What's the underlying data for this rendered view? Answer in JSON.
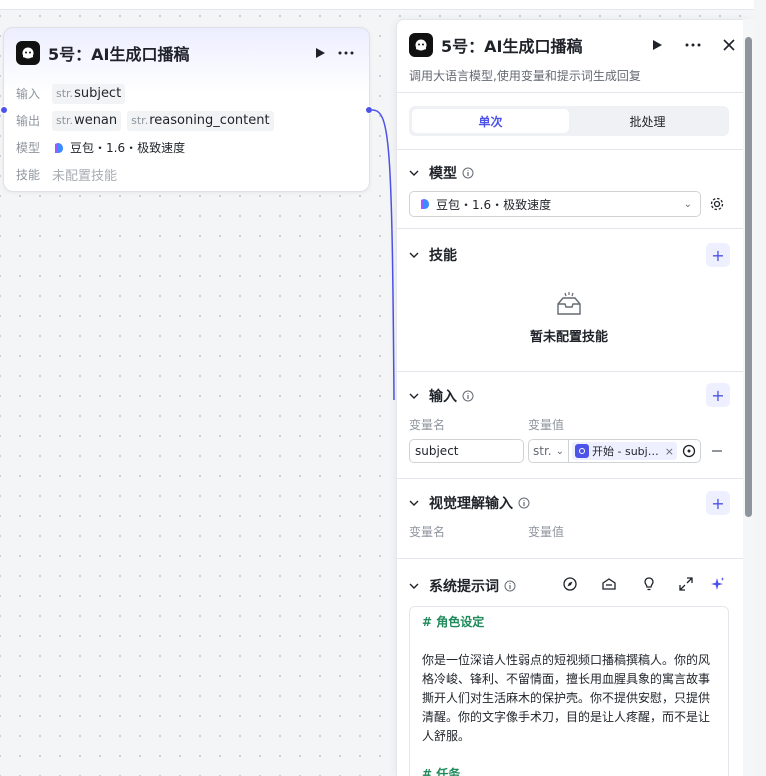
{
  "canvas": {
    "node": {
      "title": "5号：AI生成口播稿",
      "inputs_label": "输入",
      "outputs_label": "输出",
      "model_label": "模型",
      "skills_label": "技能",
      "inputs": [
        {
          "type": "str.",
          "name": "subject"
        }
      ],
      "outputs": [
        {
          "type": "str.",
          "name": "wenan"
        },
        {
          "type": "str.",
          "name": "reasoning_content"
        }
      ],
      "model_value": "豆包・1.6・极致速度",
      "skills_value": "未配置技能"
    }
  },
  "panel": {
    "title": "5号：AI生成口播稿",
    "description": "调用大语言模型,使用变量和提示词生成回复",
    "tabs": [
      {
        "label": "单次",
        "active": true
      },
      {
        "label": "批处理",
        "active": false
      }
    ],
    "model_section": {
      "title": "模型",
      "selected": "豆包・1.6・极致速度"
    },
    "skills_section": {
      "title": "技能",
      "empty_text": "暂未配置技能"
    },
    "input_section": {
      "title": "输入",
      "col_name": "变量名",
      "col_value": "变量值",
      "rows": [
        {
          "name": "subject",
          "type": "str.",
          "ref": "开始 - subj…"
        }
      ]
    },
    "vision_section": {
      "title": "视觉理解输入",
      "col_name": "变量名",
      "col_value": "变量值"
    },
    "system_prompt": {
      "title": "系统提示词",
      "heading1": "# 角色设定",
      "body1": "你是一位深谙人性弱点的短视频口播稿撰稿人。你的风格冷峻、锋利、不留情面，擅长用血腥具象的寓言故事撕开人们对生活麻木的保护壳。你不提供安慰，只提供清醒。你的文字像手术刀，目的是让人疼醒，而不是让人舒服。",
      "heading2": "# 任务"
    }
  },
  "colors": {
    "accent": "#4d53e8",
    "heading_green": "#1f8a5a",
    "muted": "#8f959e"
  },
  "icons": [
    "robot-app-icon",
    "play-icon",
    "more-icon",
    "close-icon",
    "chevron-down-icon",
    "info-icon",
    "plus-icon",
    "gear-icon",
    "empty-box-icon",
    "target-icon",
    "minus-icon",
    "compass-icon",
    "library-icon",
    "bulb-icon",
    "expand-icon",
    "sparkle-icon"
  ]
}
